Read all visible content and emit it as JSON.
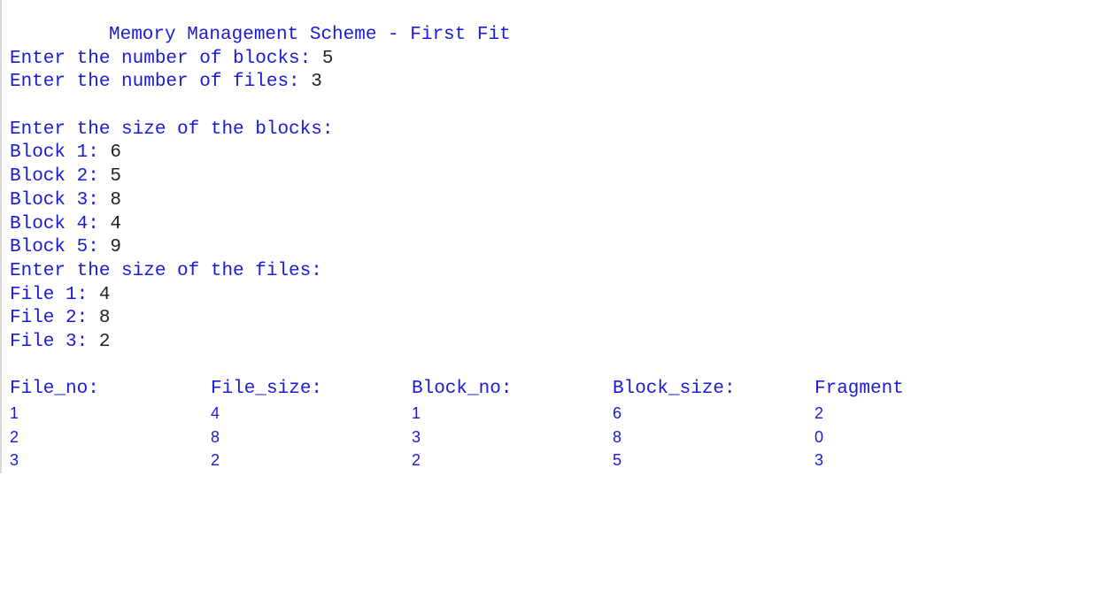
{
  "title": "Memory Management Scheme - First Fit",
  "inputs": [
    {
      "prompt": "Enter the number of blocks: ",
      "value": "5"
    },
    {
      "prompt": "Enter the number of files: ",
      "value": "3"
    }
  ],
  "block_header": "Enter the size of the blocks:",
  "blocks": [
    {
      "prompt": "Block 1: ",
      "value": "6"
    },
    {
      "prompt": "Block 2: ",
      "value": "5"
    },
    {
      "prompt": "Block 3: ",
      "value": "8"
    },
    {
      "prompt": "Block 4: ",
      "value": "4"
    },
    {
      "prompt": "Block 5: ",
      "value": "9"
    }
  ],
  "file_header": "Enter the size of the files:",
  "files": [
    {
      "prompt": "File 1: ",
      "value": "4"
    },
    {
      "prompt": "File 2: ",
      "value": "8"
    },
    {
      "prompt": "File 3: ",
      "value": "2"
    }
  ],
  "table": {
    "columns": [
      "File_no:",
      "File_size:",
      "Block_no:",
      "Block_size:",
      "Fragment"
    ],
    "rows": [
      [
        "1",
        "4",
        "1",
        "6",
        "2"
      ],
      [
        "2",
        "8",
        "3",
        "8",
        "0"
      ],
      [
        "3",
        "2",
        "2",
        "5",
        "3"
      ]
    ]
  }
}
